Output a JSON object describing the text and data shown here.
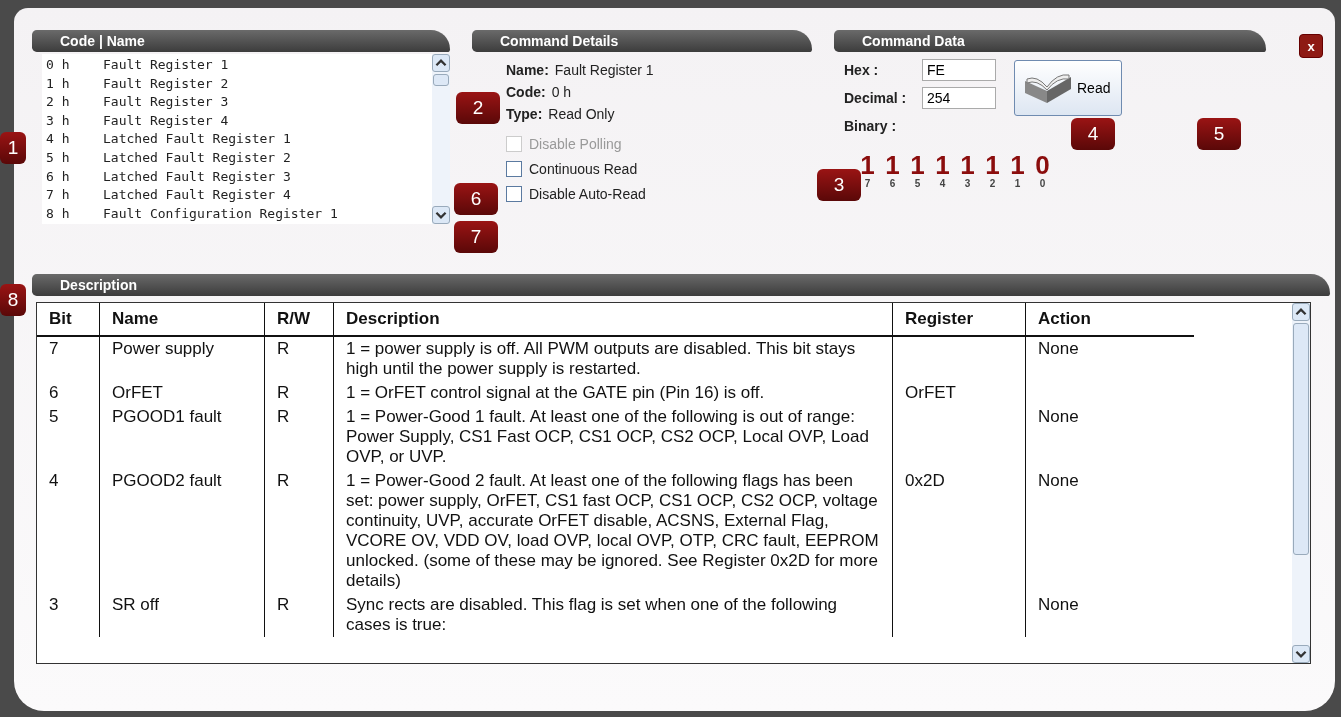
{
  "code_list": {
    "header": "Code | Name",
    "items": [
      {
        "code": "0 h",
        "name": "Fault Register 1",
        "selected": false
      },
      {
        "code": "1 h",
        "name": "Fault Register 2",
        "selected": false
      },
      {
        "code": "2 h",
        "name": "Fault Register 3",
        "selected": false
      },
      {
        "code": "3 h",
        "name": "Fault Register 4",
        "selected": false
      },
      {
        "code": "4 h",
        "name": "Latched Fault Register 1",
        "selected": false
      },
      {
        "code": "5 h",
        "name": "Latched Fault Register 2",
        "selected": false
      },
      {
        "code": "6 h",
        "name": "Latched Fault Register 3",
        "selected": false
      },
      {
        "code": "7 h",
        "name": "Latched Fault Register 4",
        "selected": false
      },
      {
        "code": "8 h",
        "name": "Fault Configuration Register 1",
        "selected": false
      }
    ]
  },
  "command_details": {
    "header": "Command Details",
    "fields": [
      {
        "label": "Name:",
        "value": "Fault Register 1"
      },
      {
        "label": "Code:",
        "value": "0 h"
      },
      {
        "label": "Type:",
        "value": "Read Only"
      }
    ],
    "options": [
      {
        "label": "Disable Polling",
        "checked": false,
        "disabled": true
      },
      {
        "label": "Continuous Read",
        "checked": false,
        "disabled": false
      },
      {
        "label": "Disable Auto-Read",
        "checked": false,
        "disabled": false
      }
    ]
  },
  "command_data": {
    "header": "Command Data",
    "hex_label": "Hex :",
    "hex": "FE",
    "decimal_label": "Decimal :",
    "decimal": "254",
    "binary_label": "Binary :",
    "read_button": "Read",
    "bits": [
      {
        "value": "1",
        "index": "7"
      },
      {
        "value": "1",
        "index": "6"
      },
      {
        "value": "1",
        "index": "5"
      },
      {
        "value": "1",
        "index": "4"
      },
      {
        "value": "1",
        "index": "3"
      },
      {
        "value": "1",
        "index": "2"
      },
      {
        "value": "1",
        "index": "1"
      },
      {
        "value": "0",
        "index": "0"
      }
    ]
  },
  "close_button": "x",
  "description": {
    "header": "Description",
    "columns": [
      "Bit",
      "Name",
      "R/W",
      "Description",
      "Register",
      "Action"
    ],
    "rows": [
      [
        "7",
        "Power supply",
        "R",
        "1 = power supply is off. All PWM outputs are disabled. This bit stays high until the power supply is restarted.",
        "",
        "None"
      ],
      [
        "6",
        "OrFET",
        "R",
        "1 = OrFET control signal at the GATE pin (Pin 16) is off.",
        "OrFET",
        ""
      ],
      [
        "5",
        "PGOOD1 fault",
        "R",
        "1 = Power-Good 1 fault. At least one of the following is out of range: Power Supply, CS1 Fast OCP, CS1 OCP, CS2 OCP, Local OVP, Load OVP, or UVP.",
        "",
        "None"
      ],
      [
        "4",
        "PGOOD2 fault",
        "R",
        "1 = Power-Good 2 fault. At least one of the following flags has been set: power supply, OrFET, CS1 fast OCP, CS1 OCP, CS2 OCP, voltage continuity, UVP, accurate OrFET disable, ACSNS, External Flag, VCORE OV, VDD OV, load OVP, local OVP, OTP, CRC fault, EEPROM unlocked. (some of these may be ignored. See Register 0x2D for more details)",
        "0x2D",
        "None"
      ],
      [
        "3",
        "SR off",
        "R",
        "Sync rects are disabled. This flag is set when one of the following cases is true:",
        "",
        "None"
      ]
    ]
  },
  "callouts": [
    "1",
    "2",
    "3",
    "4",
    "5",
    "6",
    "7",
    "8"
  ]
}
